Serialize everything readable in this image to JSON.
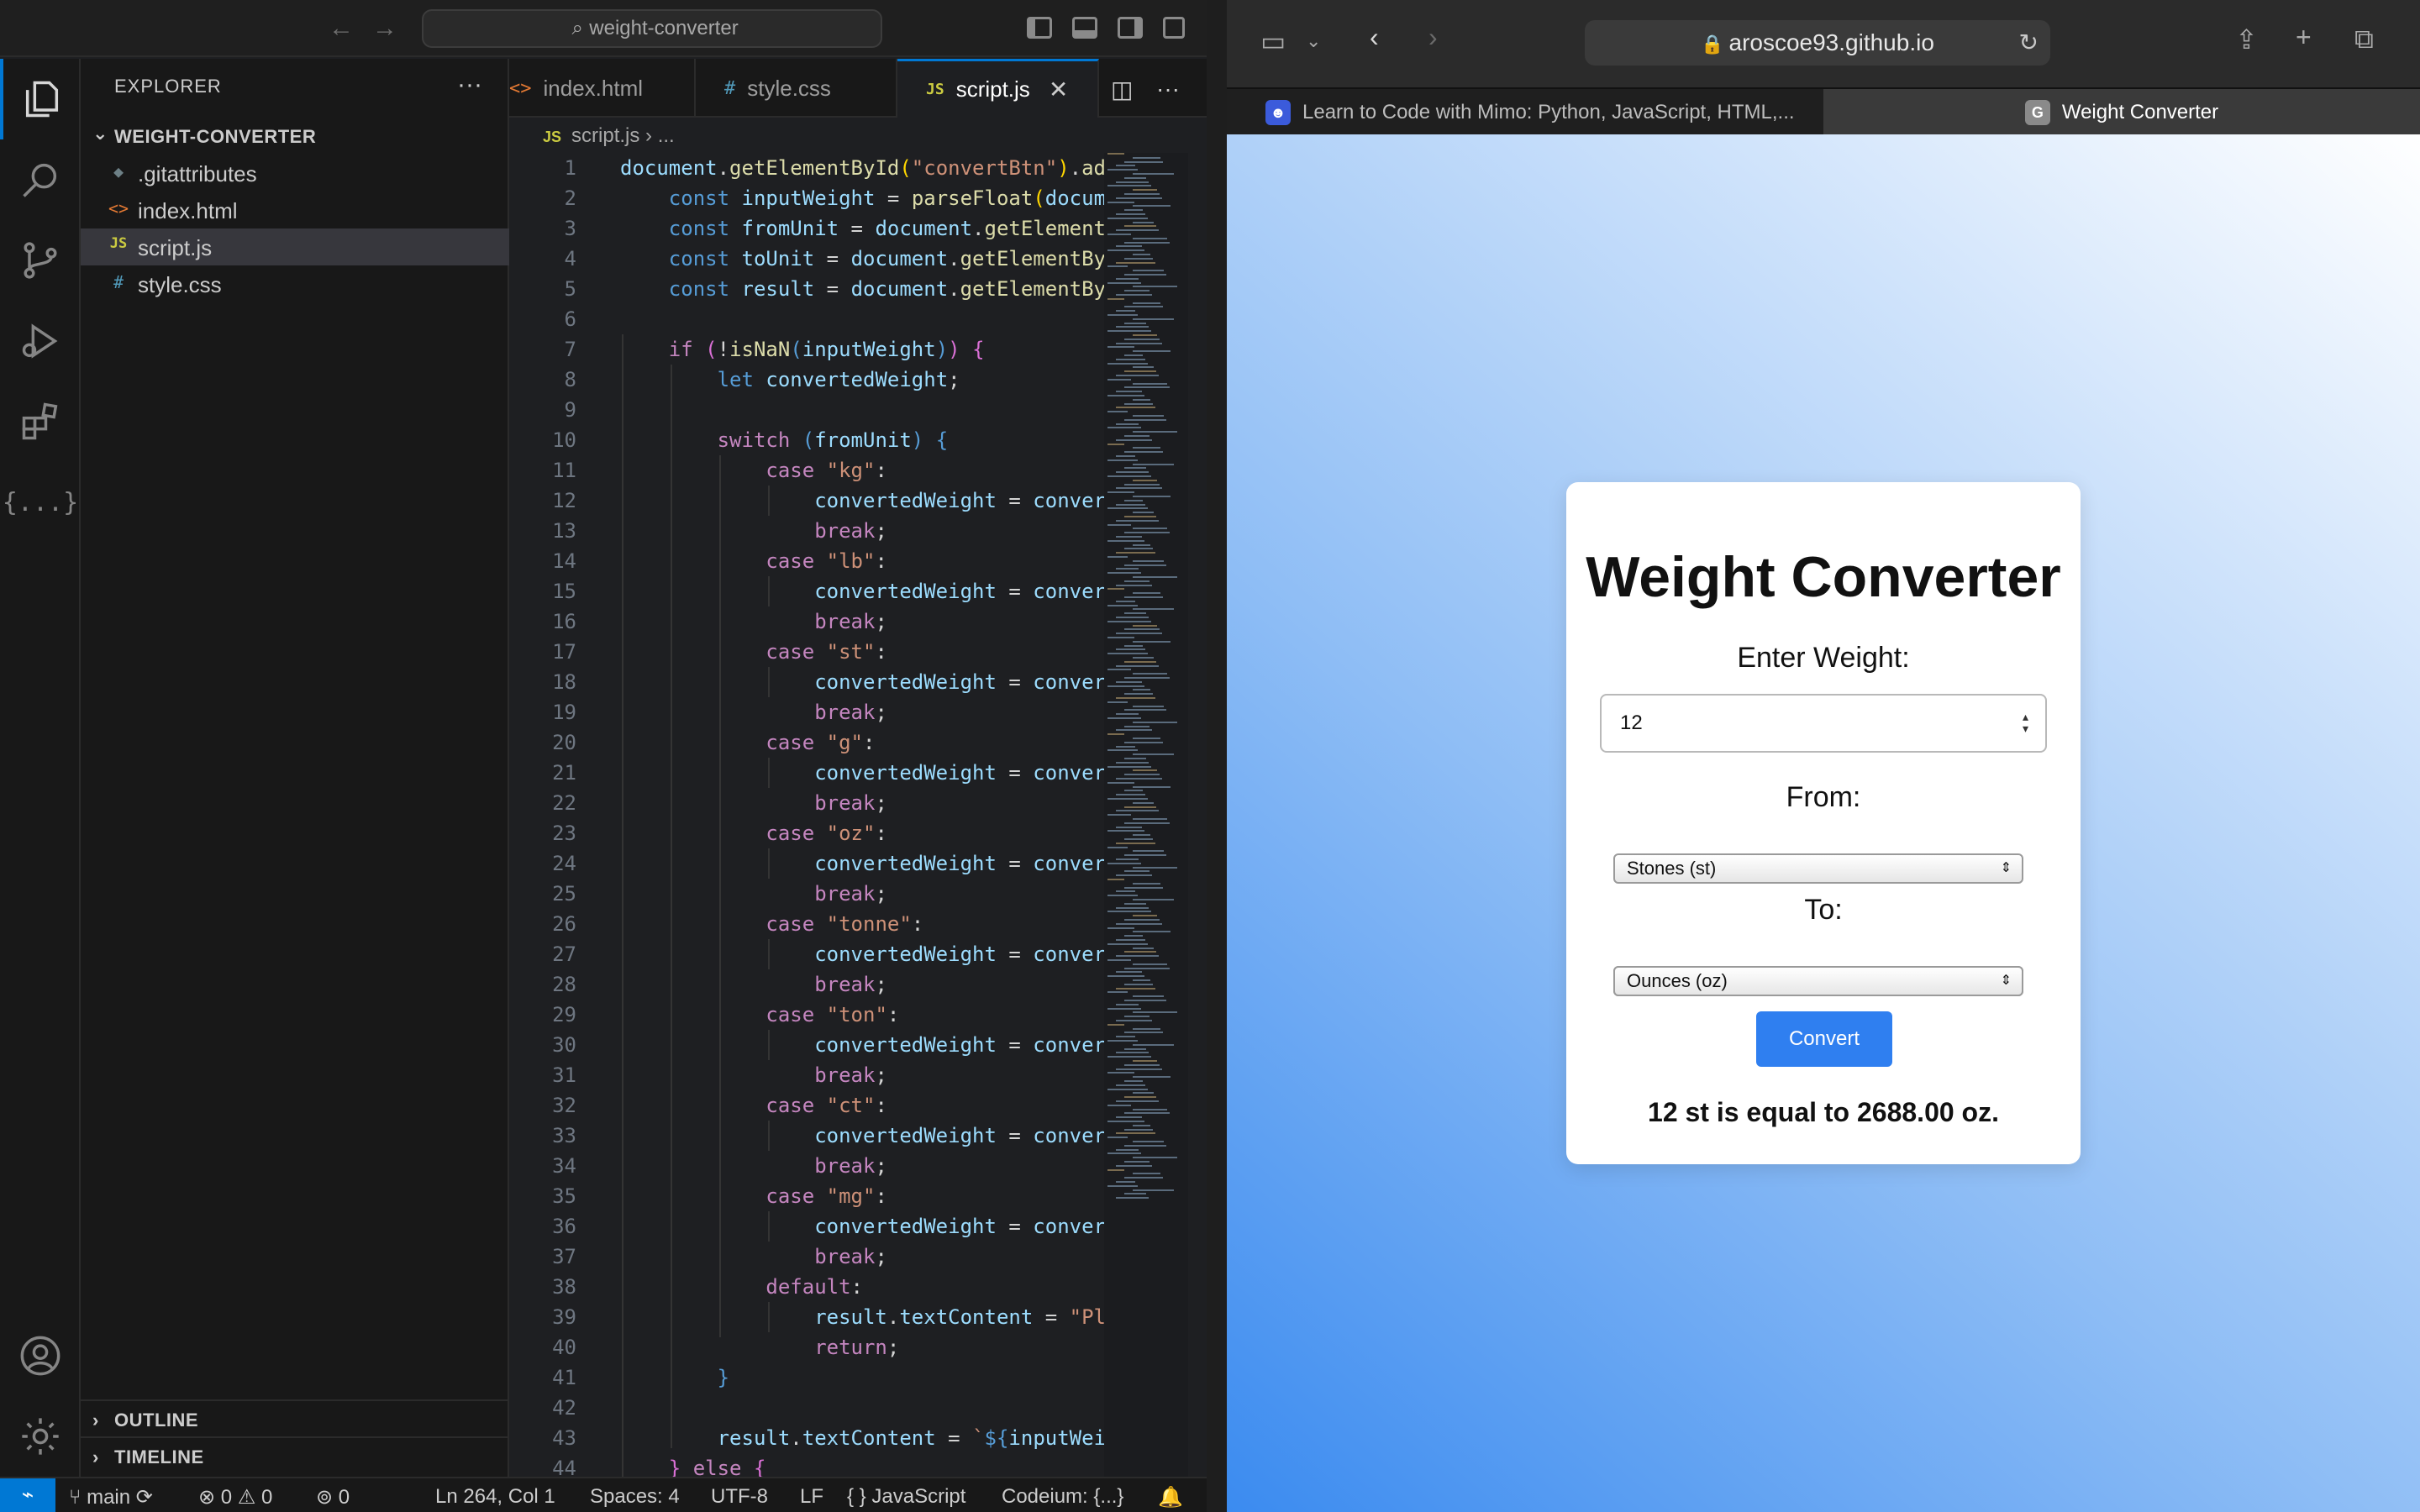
{
  "vscode": {
    "search_text": "weight-converter",
    "explorer": {
      "title": "EXPLORER",
      "more": "···",
      "folder": "WEIGHT-CONVERTER",
      "files": [
        {
          "icon": "◆",
          "name": ".gitattributes"
        },
        {
          "icon": "<>",
          "name": "index.html"
        },
        {
          "icon": "JS",
          "name": "script.js"
        },
        {
          "icon": "#",
          "name": "style.css"
        }
      ],
      "outline": "OUTLINE",
      "timeline": "TIMELINE"
    },
    "tabs": [
      {
        "icon": "<>",
        "label": "index.html"
      },
      {
        "icon": "#",
        "label": "style.css"
      },
      {
        "icon": "JS",
        "label": "script.js",
        "close": "✕"
      }
    ],
    "tab_actions": {
      "split": "◫",
      "more": "···"
    },
    "breadcrumb": {
      "icon": "JS",
      "file": "script.js",
      "sep": "›",
      "rest": "..."
    },
    "code_lines": [
      "1",
      "2",
      "3",
      "4",
      "5",
      "6",
      "7",
      "8",
      "9",
      "10",
      "11",
      "12",
      "13",
      "14",
      "15",
      "16",
      "17",
      "18",
      "19",
      "20",
      "21",
      "22",
      "23",
      "24",
      "25",
      "26",
      "27",
      "28",
      "29",
      "30",
      "31",
      "32",
      "33",
      "34",
      "35",
      "36",
      "37",
      "38",
      "39",
      "40",
      "41",
      "42",
      "43",
      "44"
    ],
    "statusbar": {
      "remote": "⌁",
      "branch": "main",
      "sync": "⟳",
      "errors": "0",
      "warnings": "0",
      "ports": "0",
      "position": "Ln 264, Col 1",
      "spaces": "Spaces: 4",
      "encoding": "UTF-8",
      "eol": "LF",
      "language": "JavaScript",
      "language_icon": "{ }",
      "codeium": "Codeium: {...}"
    }
  },
  "safari": {
    "url": "aroscoe93.github.io",
    "tabs": [
      {
        "favicon": "☻",
        "title": "Learn to Code with Mimo: Python, JavaScript, HTML,..."
      },
      {
        "favicon": "G",
        "title": "Weight Converter"
      }
    ]
  },
  "app": {
    "title": "Weight Converter",
    "enter_label": "Enter Weight:",
    "weight_value": "12",
    "from_label": "From:",
    "from_value": "Stones (st)",
    "to_label": "To:",
    "to_value": "Ounces (oz)",
    "button": "Convert",
    "result": "12 st is equal to 2688.00 oz."
  },
  "colors": {
    "accent": "#0078d4",
    "button": "#2f7ff0"
  }
}
